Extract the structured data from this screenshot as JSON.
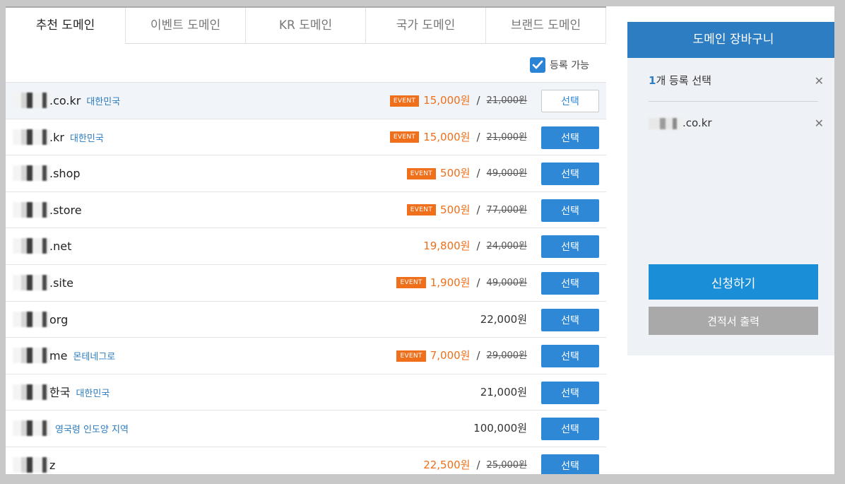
{
  "tabs": [
    {
      "label": "추천 도메인",
      "active": true
    },
    {
      "label": "이벤트 도메인"
    },
    {
      "label": "KR 도메인"
    },
    {
      "label": "국가 도메인"
    },
    {
      "label": "브랜드 도메인"
    }
  ],
  "filter": {
    "label": "등록 가능",
    "checked": true
  },
  "domains": [
    {
      "name": ".co.kr",
      "sub": "대한민국",
      "event": "EVENT",
      "price": "15,000원",
      "slash": "/",
      "orig": "21,000원",
      "button": "선택",
      "selected": true
    },
    {
      "name": ".kr",
      "sub": "대한민국",
      "event": "EVENT",
      "price": "15,000원",
      "slash": "/",
      "orig": "21,000원",
      "button": "선택"
    },
    {
      "name": ".shop",
      "event": "EVENT",
      "price": "500원",
      "slash": "/",
      "orig": "49,000원",
      "button": "선택"
    },
    {
      "name": ".store",
      "event": "EVENT",
      "price": "500원",
      "slash": "/",
      "orig": "77,000원",
      "button": "선택"
    },
    {
      "name": ".net",
      "price": "19,800원",
      "slash": "/",
      "orig": "24,000원",
      "button": "선택"
    },
    {
      "name": ".site",
      "event": "EVENT",
      "price": "1,900원",
      "slash": "/",
      "orig": "49,000원",
      "button": "선택"
    },
    {
      "name": "org",
      "plain": "22,000원",
      "button": "선택"
    },
    {
      "name": "me",
      "sub": "몬테네그로",
      "event": "EVENT",
      "price": "7,000원",
      "slash": "/",
      "orig": "29,000원",
      "button": "선택"
    },
    {
      "name": "한국",
      "sub": "대한민국",
      "plain": "21,000원",
      "button": "선택"
    },
    {
      "name": "",
      "sub": "영국령 인도양 지역",
      "plain": "100,000원",
      "button": "선택"
    },
    {
      "name": "z",
      "price": "22,500원",
      "slash": "/",
      "orig": "25,000원",
      "button": "선택"
    }
  ],
  "cart": {
    "title": "도메인 장바구니",
    "count_num": "1",
    "count_text": "개 등록 선택",
    "item": ".co.kr",
    "close": "✕",
    "apply": "신청하기",
    "quote": "견적서 출력"
  }
}
